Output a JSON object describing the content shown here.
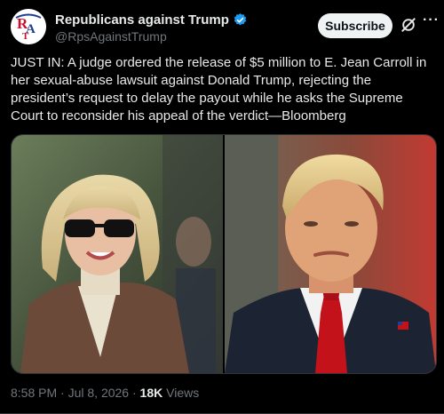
{
  "account": {
    "name": "Republicans against Trump",
    "handle": "@RpsAgainstTrump",
    "avatar_text": "RAT",
    "verified": true
  },
  "actions": {
    "subscribe_label": "Subscribe",
    "more_label": "···"
  },
  "tweet": {
    "text": "JUST IN: A judge ordered the release of $5 million to E. Jean Carroll in her sexual-abuse lawsuit against Donald Trump, rejecting the president’s request to delay the payout while he asks the Supreme Court to reconsider his appeal of the verdict—Bloomberg"
  },
  "meta": {
    "time": "8:58 PM",
    "date": "Jul 8, 2026",
    "views_count": "18K",
    "views_label": "Views"
  },
  "colors": {
    "background": "#000000",
    "text": "#e7e9ea",
    "muted": "#71767b",
    "verified": "#1d9bf0",
    "subscribe_bg": "#eff3f4"
  }
}
